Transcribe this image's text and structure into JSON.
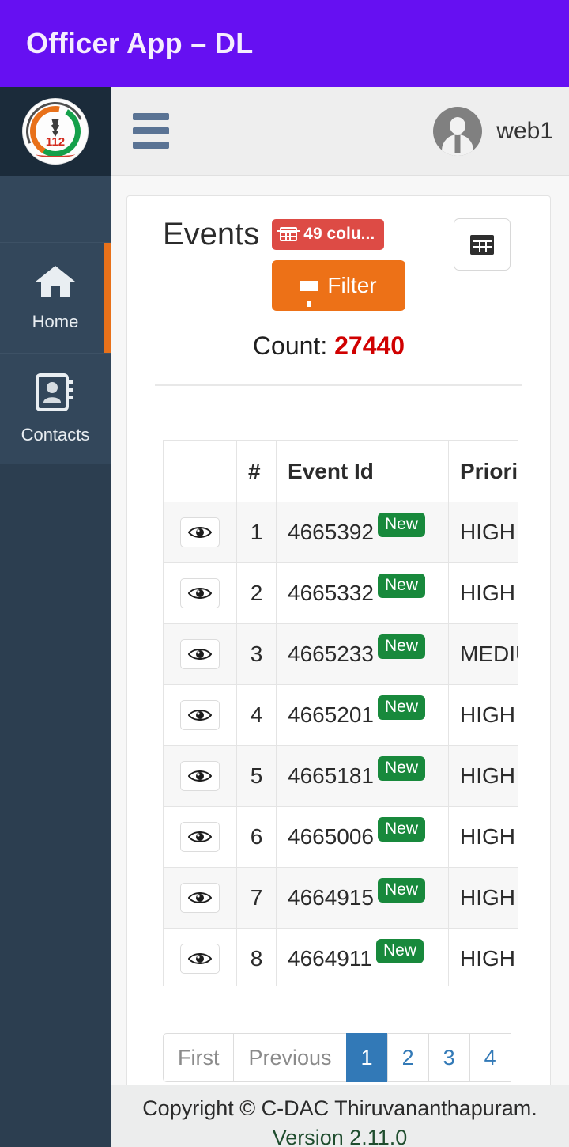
{
  "appbar": {
    "title": "Officer App – DL"
  },
  "sidebar": {
    "logo_label": "112-logo",
    "items": [
      {
        "label": "Home",
        "icon": "home-icon",
        "active": true
      },
      {
        "label": "Contacts",
        "icon": "contacts-icon",
        "active": false
      }
    ]
  },
  "topbar": {
    "menu_icon": "hamburger-icon",
    "avatar_icon": "user-avatar-icon",
    "username": "web1"
  },
  "main": {
    "page_title": "Events",
    "columns_badge": "49 colu...",
    "columns_badge_icon": "grid-icon",
    "table_toggle_icon": "table-icon",
    "filter_label": "Filter",
    "filter_icon": "funnel-icon",
    "count_label": "Count:",
    "count_value": "27440"
  },
  "table": {
    "headers": [
      "",
      "#",
      "Event Id",
      "Priority"
    ],
    "rows": [
      {
        "num": "1",
        "event_id": "4665392",
        "badge": "New",
        "priority": "HIGH"
      },
      {
        "num": "2",
        "event_id": "4665332",
        "badge": "New",
        "priority": "HIGH"
      },
      {
        "num": "3",
        "event_id": "4665233",
        "badge": "New",
        "priority": "MEDIUM"
      },
      {
        "num": "4",
        "event_id": "4665201",
        "badge": "New",
        "priority": "HIGH"
      },
      {
        "num": "5",
        "event_id": "4665181",
        "badge": "New",
        "priority": "HIGH"
      },
      {
        "num": "6",
        "event_id": "4665006",
        "badge": "New",
        "priority": "HIGH"
      },
      {
        "num": "7",
        "event_id": "4664915",
        "badge": "New",
        "priority": "HIGH"
      },
      {
        "num": "8",
        "event_id": "4664911",
        "badge": "New",
        "priority": "HIGH"
      }
    ]
  },
  "pagination": {
    "first": "First",
    "previous": "Previous",
    "pages": [
      "1",
      "2",
      "3",
      "4"
    ],
    "active_page": "1"
  },
  "footer": {
    "copyright": "Copyright © C-DAC Thiruvananthapuram.",
    "version": "Version 2.11.0"
  },
  "colors": {
    "appbar": "#6610f2",
    "sidebar": "#33475b",
    "sidebar_dark": "#2c3e50",
    "accent_orange": "#ed7117",
    "badge_red": "#dd4b45",
    "badge_green": "#18893c",
    "count_red": "#d00000",
    "pager_blue": "#3279b7"
  }
}
